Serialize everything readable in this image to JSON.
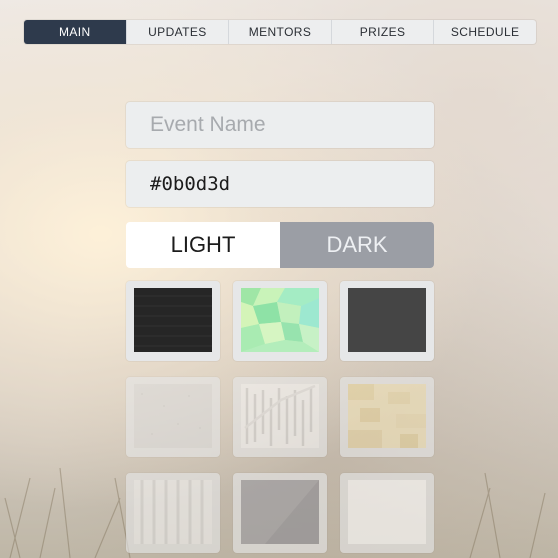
{
  "nav": {
    "tabs": [
      {
        "label": "MAIN",
        "active": true
      },
      {
        "label": "UPDATES"
      },
      {
        "label": "MENTORS"
      },
      {
        "label": "PRIZES"
      },
      {
        "label": "SCHEDULE"
      }
    ]
  },
  "form": {
    "event_name_placeholder": "Event Name",
    "color_value": "#0b0d3d"
  },
  "theme_toggle": {
    "light_label": "LIGHT",
    "dark_label": "DARK",
    "selected": "LIGHT"
  },
  "backgrounds": [
    {
      "name": "dark-fabric"
    },
    {
      "name": "green-polygons"
    },
    {
      "name": "dark-gray"
    },
    {
      "name": "light-texture"
    },
    {
      "name": "white-zigzag"
    },
    {
      "name": "beige-blocks"
    },
    {
      "name": "white-stripes"
    },
    {
      "name": "gray-diagonal"
    },
    {
      "name": "white-plain"
    }
  ],
  "colors": {
    "nav_active": "#2e3a4c",
    "dark_toggle": "#9b9ea5"
  }
}
